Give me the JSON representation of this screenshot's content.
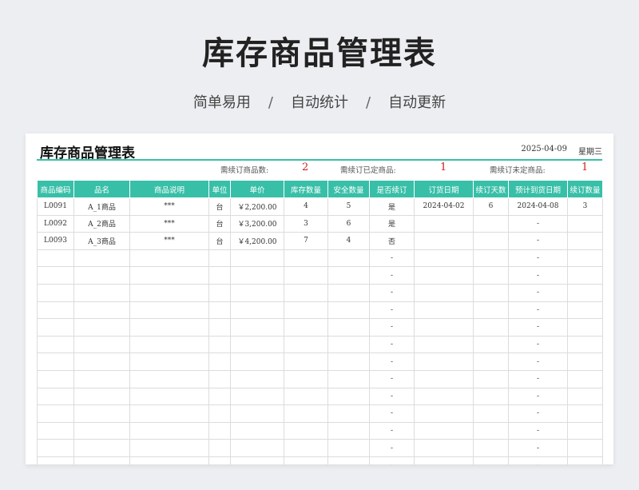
{
  "hero": {
    "title": "库存商品管理表",
    "tags": [
      "简单易用",
      "自动统计",
      "自动更新"
    ],
    "separator": "/"
  },
  "sheet": {
    "title": "库存商品管理表",
    "date": "2025-04-09",
    "weekday": "星期三",
    "summary": {
      "need_order_label": "需续订商品数:",
      "need_order_value": "2",
      "ordered_label": "需续订已定商品:",
      "ordered_value": "1",
      "unordered_label": "需续订未定商品:",
      "unordered_value": "1"
    },
    "columns": [
      "商品编码",
      "品名",
      "商品说明",
      "单位",
      "单价",
      "库存数量",
      "安全数量",
      "是否续订",
      "订货日期",
      "续订天数",
      "预计到货日期",
      "续订数量"
    ],
    "rows": [
      [
        "L0091",
        "A_1商品",
        "***",
        "台",
        "￥2,200.00",
        "4",
        "5",
        "是",
        "2024-04-02",
        "6",
        "2024-04-08",
        "3"
      ],
      [
        "L0092",
        "A_2商品",
        "***",
        "台",
        "￥3,200.00",
        "3",
        "6",
        "是",
        "",
        "",
        "-",
        ""
      ],
      [
        "L0093",
        "A_3商品",
        "***",
        "台",
        "￥4,200.00",
        "7",
        "4",
        "否",
        "",
        "",
        "-",
        ""
      ],
      [
        "",
        "",
        "",
        "",
        "",
        "",
        "",
        "-",
        "",
        "",
        "-",
        ""
      ],
      [
        "",
        "",
        "",
        "",
        "",
        "",
        "",
        "-",
        "",
        "",
        "-",
        ""
      ],
      [
        "",
        "",
        "",
        "",
        "",
        "",
        "",
        "-",
        "",
        "",
        "-",
        ""
      ],
      [
        "",
        "",
        "",
        "",
        "",
        "",
        "",
        "-",
        "",
        "",
        "-",
        ""
      ],
      [
        "",
        "",
        "",
        "",
        "",
        "",
        "",
        "-",
        "",
        "",
        "-",
        ""
      ],
      [
        "",
        "",
        "",
        "",
        "",
        "",
        "",
        "-",
        "",
        "",
        "-",
        ""
      ],
      [
        "",
        "",
        "",
        "",
        "",
        "",
        "",
        "-",
        "",
        "",
        "-",
        ""
      ],
      [
        "",
        "",
        "",
        "",
        "",
        "",
        "",
        "-",
        "",
        "",
        "-",
        ""
      ],
      [
        "",
        "",
        "",
        "",
        "",
        "",
        "",
        "-",
        "",
        "",
        "-",
        ""
      ],
      [
        "",
        "",
        "",
        "",
        "",
        "",
        "",
        "-",
        "",
        "",
        "-",
        ""
      ],
      [
        "",
        "",
        "",
        "",
        "",
        "",
        "",
        "-",
        "",
        "",
        "-",
        ""
      ],
      [
        "",
        "",
        "",
        "",
        "",
        "",
        "",
        "-",
        "",
        "",
        "-",
        ""
      ],
      [
        "",
        "",
        "",
        "",
        "",
        "",
        "",
        "-",
        "",
        "",
        "-",
        ""
      ],
      [
        "",
        "",
        "",
        "",
        "",
        "",
        "",
        "-",
        "",
        "",
        "-",
        ""
      ]
    ]
  }
}
